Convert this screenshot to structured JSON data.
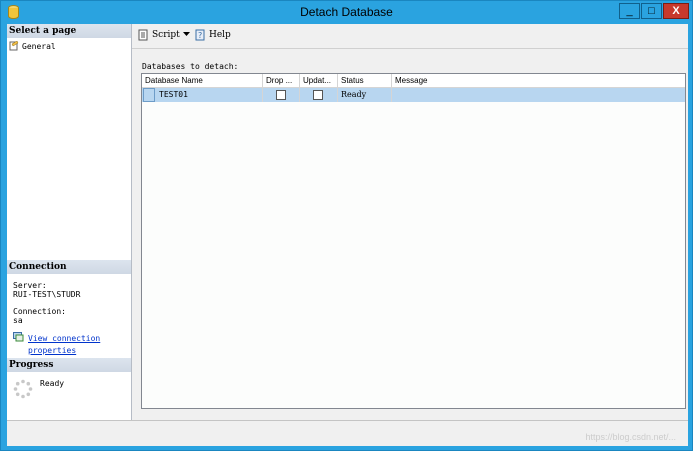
{
  "window": {
    "title": "Detach Database",
    "min_label": "_",
    "max_label": "□",
    "close_label": "X"
  },
  "left_pane": {
    "select_page_header": "Select a page",
    "pages": [
      {
        "label": "General",
        "icon": "page-icon"
      }
    ],
    "connection_header": "Connection",
    "server_label": "Server:",
    "server_value": "RUI-TEST\\STUDR",
    "connection_label": "Connection:",
    "connection_value": "sa",
    "view_properties_line1": "View connection",
    "view_properties_line2": "properties",
    "progress_header": "Progress",
    "progress_status": "Ready"
  },
  "toolbar": {
    "script_label": "Script",
    "help_label": "Help"
  },
  "main": {
    "section_label": "Databases to detach:",
    "columns": [
      "Database Name",
      "Drop ...",
      "Updat...",
      "Status",
      "Message"
    ],
    "rows": [
      {
        "database_name": "TEST01",
        "drop_connections": false,
        "update_statistics": false,
        "status": "Ready",
        "message": ""
      }
    ]
  },
  "watermark": "https://blog.csdn.net/..."
}
